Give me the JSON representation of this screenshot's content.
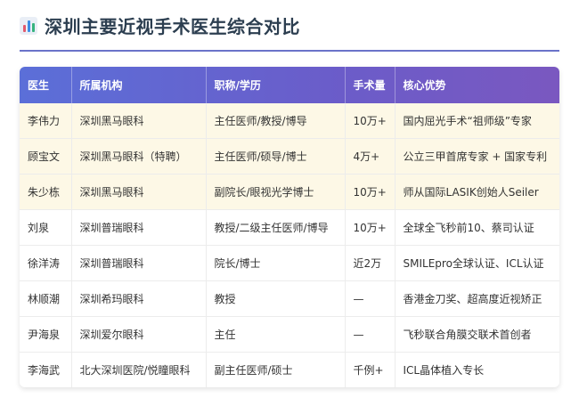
{
  "title": "深圳主要近视手术医生综合对比",
  "title_icon": "bar-chart-icon",
  "colors": {
    "header_start": "#5b6fd8",
    "header_end": "#7a58c0",
    "highlight_row": "#fdf8e6",
    "accent_line": "#6a73c9"
  },
  "table": {
    "headers": [
      "医生",
      "所属机构",
      "职称/学历",
      "手术量",
      "核心优势"
    ],
    "rows": [
      {
        "doctor": "李伟力",
        "org": "深圳黑马眼科",
        "title": "主任医师/教授/博导",
        "volume": "10万+",
        "strength": "国内屈光手术“祖师级”专家",
        "highlight": true
      },
      {
        "doctor": "顾宝文",
        "org": "深圳黑马眼科（特聘）",
        "title": "主任医师/硕导/博士",
        "volume": "4万+",
        "strength": "公立三甲首席专家 + 国家专利",
        "highlight": true
      },
      {
        "doctor": "朱少栋",
        "org": "深圳黑马眼科",
        "title": "副院长/眼视光学博士",
        "volume": "10万+",
        "strength": "师从国际LASIK创始人Seiler",
        "highlight": true
      },
      {
        "doctor": "刘泉",
        "org": "深圳普瑞眼科",
        "title": "教授/二级主任医师/博导",
        "volume": "10万+",
        "strength": "全球全飞秒前10、蔡司认证",
        "highlight": false
      },
      {
        "doctor": "徐洋涛",
        "org": "深圳普瑞眼科",
        "title": "院长/博士",
        "volume": "近2万",
        "strength": "SMILEpro全球认证、ICL认证",
        "highlight": false
      },
      {
        "doctor": "林顺潮",
        "org": "深圳希玛眼科",
        "title": "教授",
        "volume": "—",
        "strength": "香港金刀奖、超高度近视矫正",
        "highlight": false
      },
      {
        "doctor": "尹海泉",
        "org": "深圳爱尔眼科",
        "title": "主任",
        "volume": "—",
        "strength": "飞秒联合角膜交联术首创者",
        "highlight": false
      },
      {
        "doctor": "李海武",
        "org": "北大深圳医院/悦瞳眼科",
        "title": "副主任医师/硕士",
        "volume": "千例+",
        "strength": "ICL晶体植入专长",
        "highlight": false
      }
    ]
  }
}
